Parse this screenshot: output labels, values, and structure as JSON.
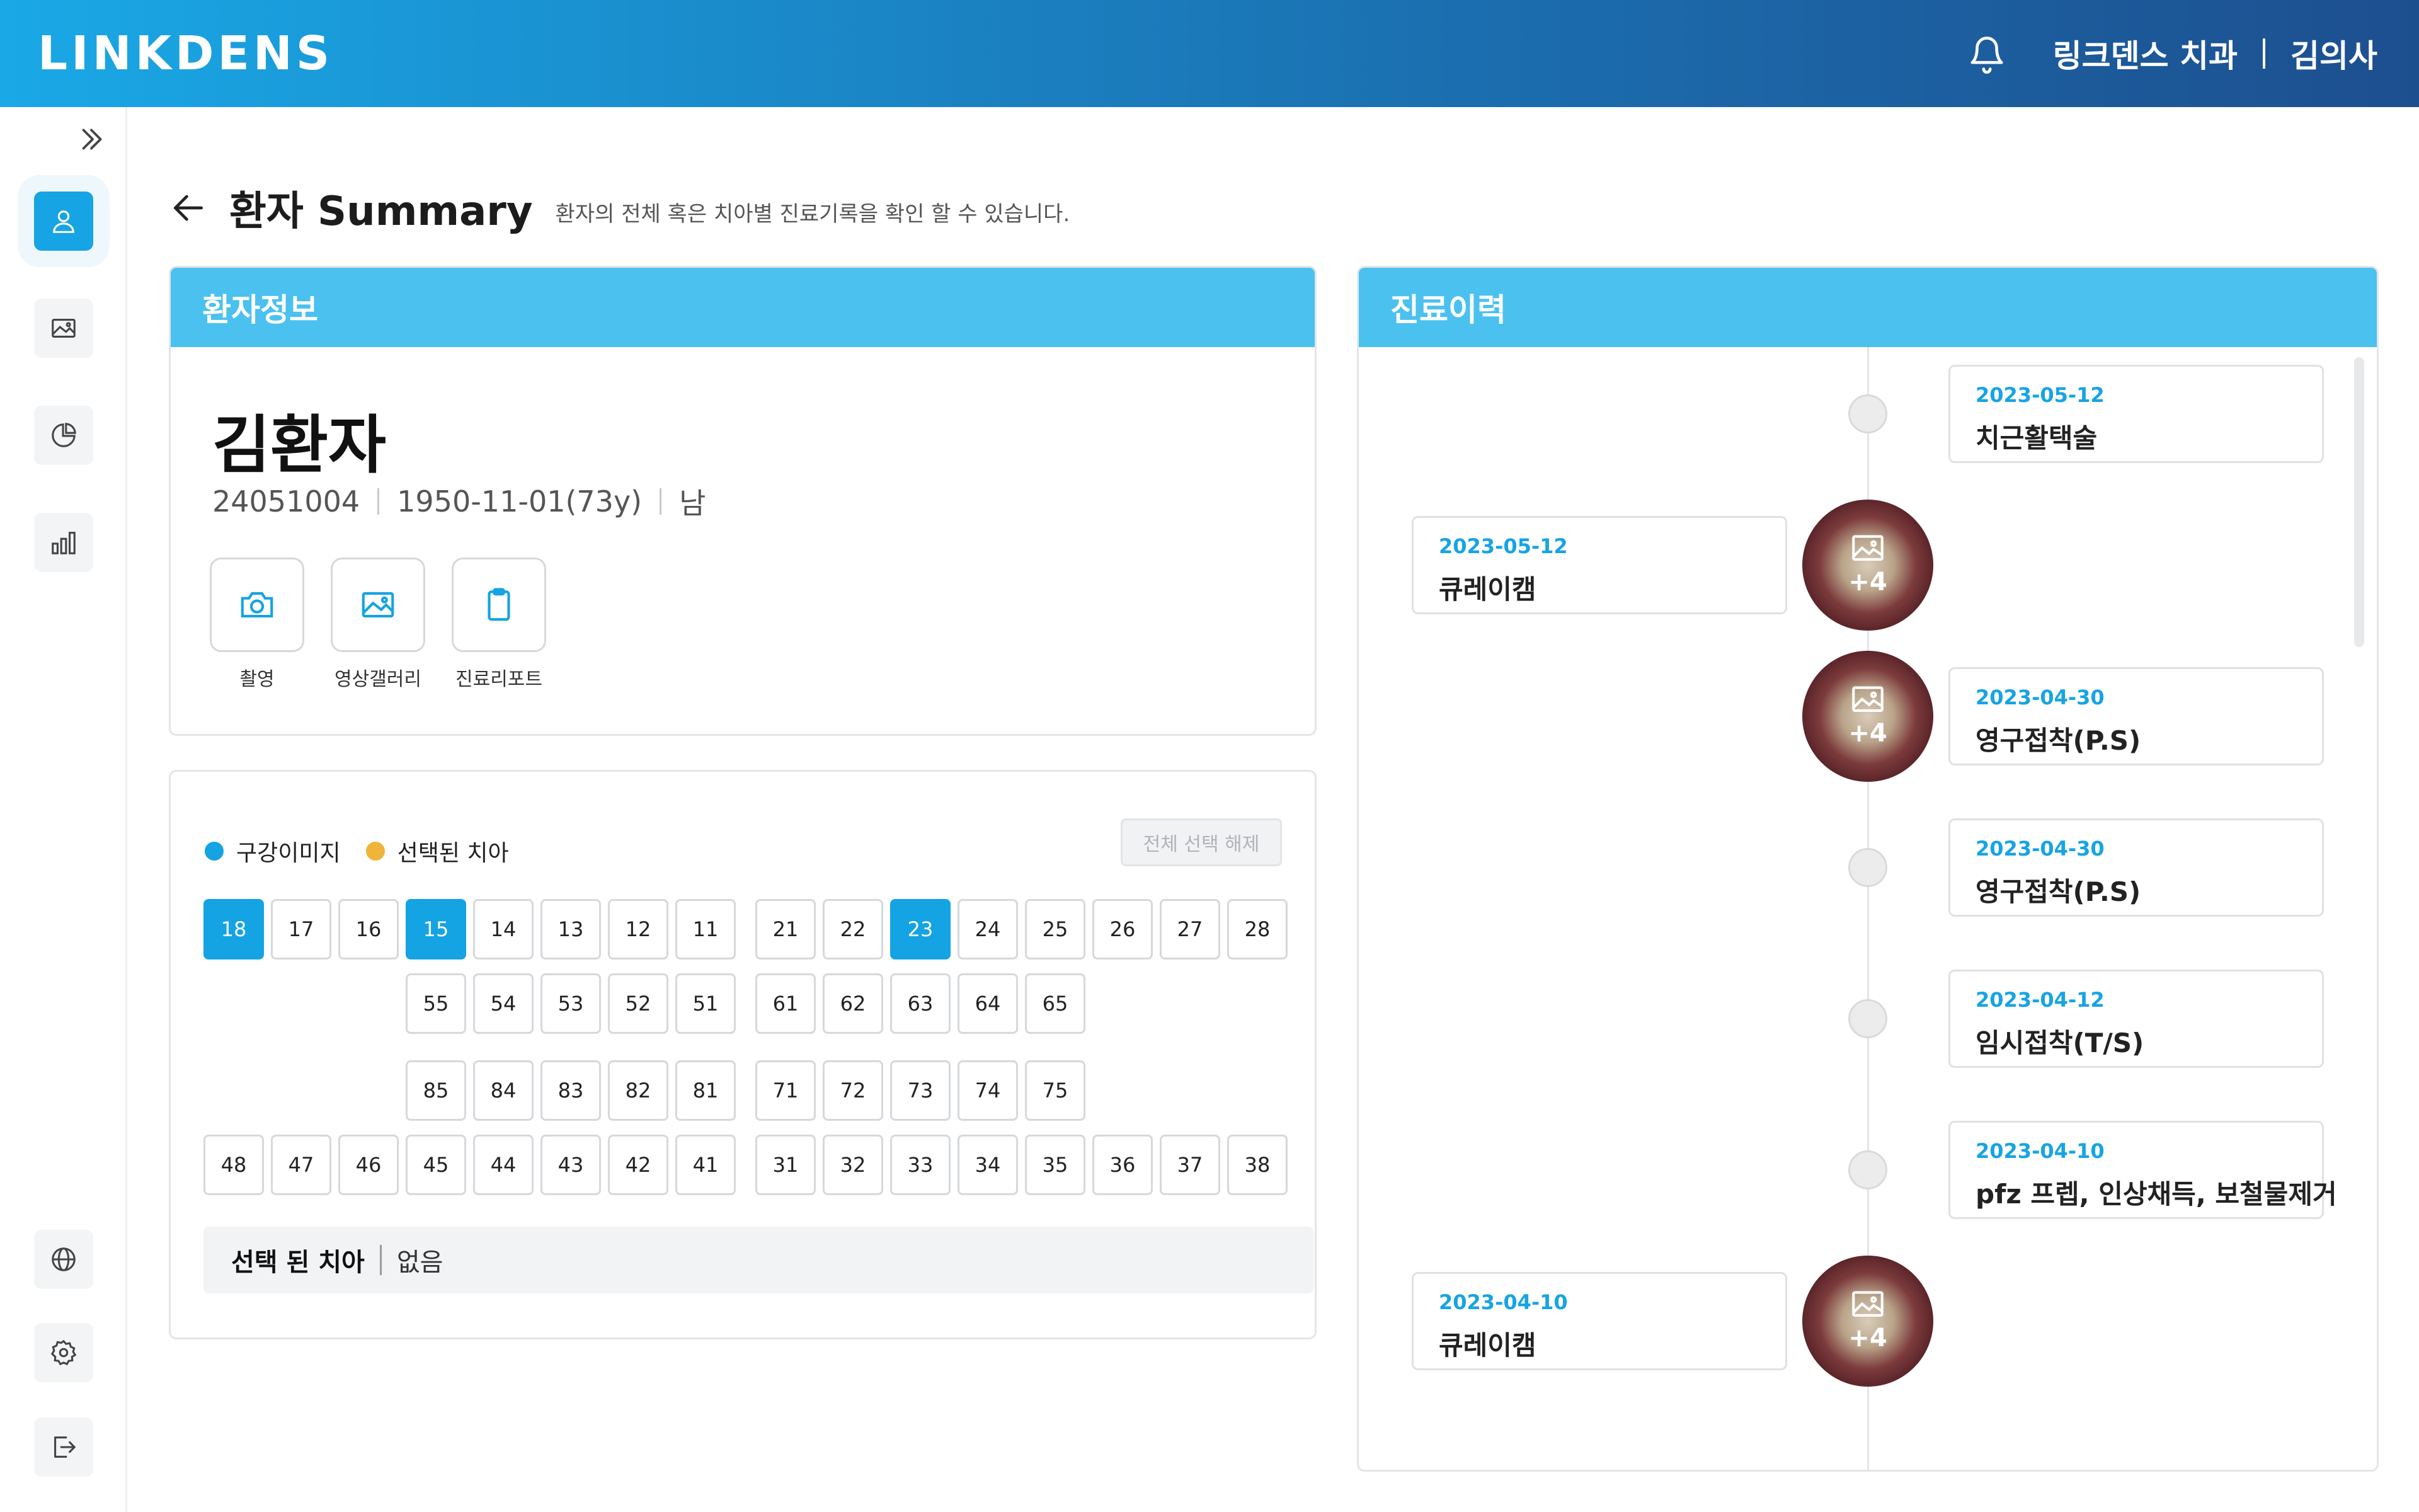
{
  "header": {
    "logo": "LINKDENS",
    "clinic": "링크덴스 치과",
    "doctor": "김의사"
  },
  "page": {
    "title": "환자 Summary",
    "subtitle": "환자의 전체 혹은 치아별 진료기록을 확인 할 수 있습니다."
  },
  "patient_panel": {
    "heading": "환자정보",
    "name": "김환자",
    "id": "24051004",
    "birth": "1950-11-01(73y)",
    "sex": "남",
    "actions": [
      "촬영",
      "영상갤러리",
      "진료리포트"
    ]
  },
  "teeth_panel": {
    "legend_oral": "구강이미지",
    "legend_selected": "선택된 치아",
    "clear_all": "전체 선택 해제",
    "colors": {
      "oral": "#14a3e3",
      "selected": "#f0b43a"
    },
    "upper_permanent": [
      "18",
      "17",
      "16",
      "15",
      "14",
      "13",
      "12",
      "11",
      "21",
      "22",
      "23",
      "24",
      "25",
      "26",
      "27",
      "28"
    ],
    "upper_primary": [
      "55",
      "54",
      "53",
      "52",
      "51",
      "61",
      "62",
      "63",
      "64",
      "65"
    ],
    "lower_primary": [
      "85",
      "84",
      "83",
      "82",
      "81",
      "71",
      "72",
      "73",
      "74",
      "75"
    ],
    "lower_permanent": [
      "48",
      "47",
      "46",
      "45",
      "44",
      "43",
      "42",
      "41",
      "31",
      "32",
      "33",
      "34",
      "35",
      "36",
      "37",
      "38"
    ],
    "highlighted": [
      "18",
      "15",
      "23"
    ],
    "selected_label": "선택 된 치아",
    "selected_value": "없음"
  },
  "history_panel": {
    "heading": "진료이력",
    "entries": [
      {
        "date": "2023-05-12",
        "title": "치근활택술",
        "side": "right",
        "image": false,
        "count": ""
      },
      {
        "date": "2023-05-12",
        "title": "큐레이캠",
        "side": "left",
        "image": true,
        "count": "+4"
      },
      {
        "date": "2023-04-30",
        "title": "영구접착(P.S)",
        "side": "right",
        "image": true,
        "count": "+4"
      },
      {
        "date": "2023-04-30",
        "title": "영구접착(P.S)",
        "side": "right",
        "image": false,
        "count": ""
      },
      {
        "date": "2023-04-12",
        "title": "임시접착(T/S)",
        "side": "right",
        "image": false,
        "count": ""
      },
      {
        "date": "2023-04-10",
        "title": "pfz 프렙, 인상채득, 보철물제거",
        "side": "right",
        "image": false,
        "count": ""
      },
      {
        "date": "2023-04-10",
        "title": "큐레이캠",
        "side": "left",
        "image": true,
        "count": "+4"
      }
    ]
  }
}
